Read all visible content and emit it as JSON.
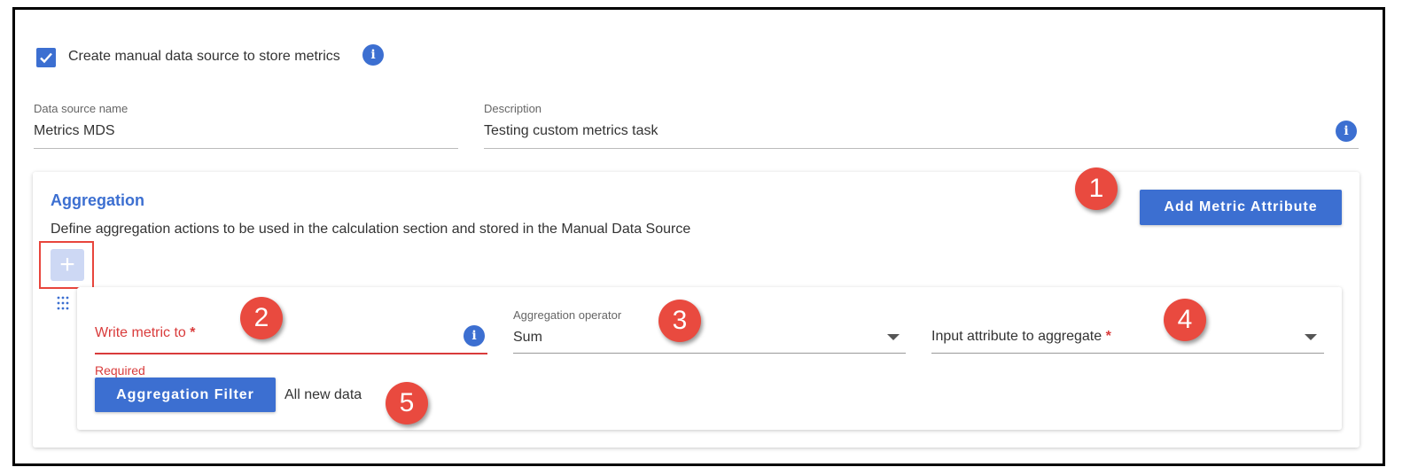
{
  "header": {
    "checkbox_label": "Create manual data source to store metrics",
    "checkbox_checked": true
  },
  "fields": {
    "data_source_name": {
      "label": "Data source name",
      "value": "Metrics MDS"
    },
    "description": {
      "label": "Description",
      "value": "Testing custom metrics task"
    }
  },
  "aggregation": {
    "title": "Aggregation",
    "description": "Define aggregation actions to be used in the calculation section and stored in the Manual Data Source",
    "add_metric_attribute_label": "Add Metric Attribute",
    "add_symbol": "+",
    "row": {
      "write_metric_to": {
        "label": "Write metric to",
        "required_mark": "*",
        "error": "Required"
      },
      "aggregation_operator": {
        "label": "Aggregation operator",
        "value": "Sum"
      },
      "input_attribute": {
        "label": "Input attribute to aggregate",
        "required_mark": "*"
      },
      "filter_button_label": "Aggregation Filter",
      "filter_value": "All new data"
    }
  },
  "callouts": [
    "1",
    "2",
    "3",
    "4",
    "5"
  ],
  "info_symbol": "i",
  "colors": {
    "accent": "#3c6fd1",
    "error": "#d93b3b",
    "callout": "#e94a3f",
    "add_disabled": "#cdd8f4"
  }
}
